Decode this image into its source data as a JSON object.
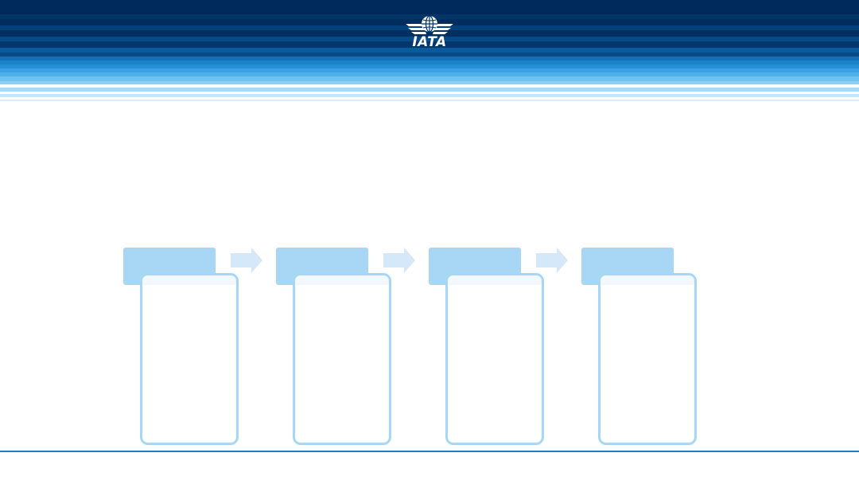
{
  "header": {
    "logo_text": "IATA",
    "logo_icon": "iata-globe-wings-icon",
    "colors": {
      "dark": "#002a5c",
      "mid": "#0a5a9c",
      "light": "#6fc3f2",
      "pale": "#d8eefb"
    }
  },
  "diagram": {
    "steps": [
      {
        "title": "",
        "body": ""
      },
      {
        "title": "",
        "body": ""
      },
      {
        "title": "",
        "body": ""
      },
      {
        "title": "",
        "body": ""
      }
    ],
    "connector_icon": "arrow-right-icon",
    "colors": {
      "tab": "#a8d6f5",
      "card_border": "#a8d6f5",
      "arrow": "#d4e8f9"
    }
  },
  "footer": {
    "rule_color": "#2b7ab8"
  }
}
